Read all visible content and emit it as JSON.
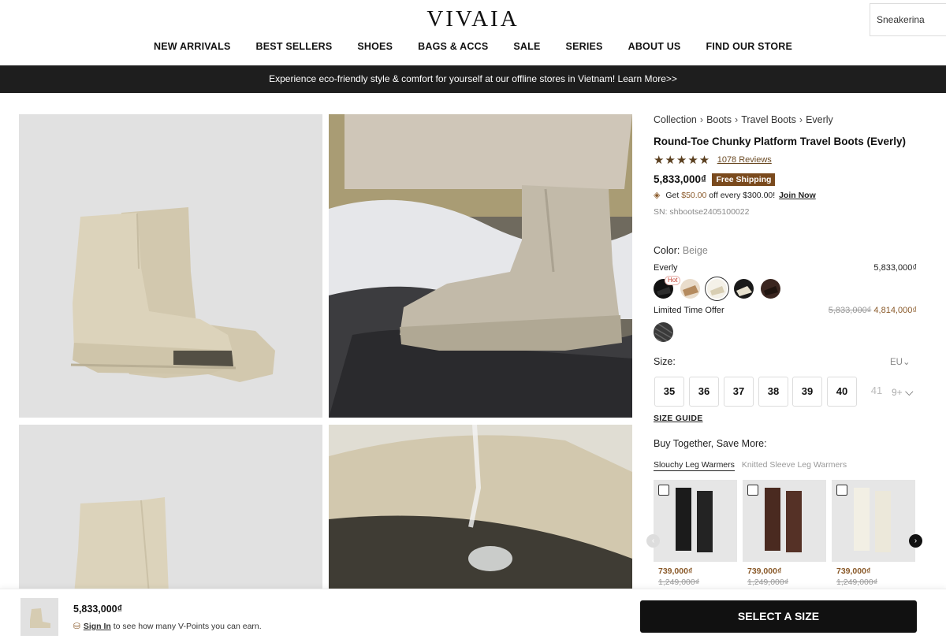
{
  "header": {
    "logo": "VIVAIA",
    "search_value": "Sneakerina",
    "nav": [
      "NEW ARRIVALS",
      "BEST SELLERS",
      "SHOES",
      "BAGS & ACCS",
      "SALE",
      "SERIES",
      "ABOUT US",
      "FIND OUR STORE"
    ]
  },
  "banner": {
    "text": "Experience eco-friendly style & comfort for yourself at our offline stores in Vietnam!  Learn More>>"
  },
  "product": {
    "breadcrumb": [
      "Collection",
      "Boots",
      "Travel Boots",
      "Everly"
    ],
    "title": "Round-Toe Chunky Platform Travel Boots (Everly)",
    "stars": "★★★★★",
    "rating": 5,
    "reviews": "1078 Reviews",
    "price": "5,833,000₫",
    "shipping_badge": "Free Shipping",
    "promo": {
      "prefix": "Get",
      "amount": "$50.00",
      "middle": "off every $300.00!",
      "link": "Join Now"
    },
    "sn": "SN: shbootse2405100022",
    "color": {
      "label": "Color:",
      "value": "Beige",
      "line_name": "Everly",
      "line_price": "5,833,000₫",
      "hot_badge": "Hot",
      "swatches": [
        {
          "name": "black",
          "color": "#111111"
        },
        {
          "name": "tan",
          "color": "#b48a5e"
        },
        {
          "name": "beige",
          "color": "#d8ceb3",
          "selected": true
        },
        {
          "name": "black-cream",
          "color": "#1a1a1a"
        },
        {
          "name": "dark-brown",
          "color": "#3b2620"
        }
      ],
      "offer_label": "Limited Time Offer",
      "offer_old_price": "5,833,000₫",
      "offer_price": "4,814,000₫",
      "offer_swatch": "grey-pattern"
    },
    "size": {
      "label": "Size:",
      "unit": "EU",
      "options": [
        "35",
        "36",
        "37",
        "38",
        "39",
        "40",
        "41"
      ],
      "more": "9+",
      "guide": "SIZE GUIDE"
    },
    "buy_together": {
      "title": "Buy Together, Save More:",
      "tabs": [
        "Slouchy Leg Warmers",
        "Knitted Sleeve Leg Warmers"
      ],
      "items": [
        {
          "price": "739,000₫",
          "old_price": "1,249,000₫",
          "color": "#1b1b1b"
        },
        {
          "price": "739,000₫",
          "old_price": "1,249,000₫",
          "color": "#4a2a20"
        },
        {
          "price": "739,000₫",
          "old_price": "1,249,000₫",
          "color": "#eeebdf"
        }
      ]
    }
  },
  "sticky": {
    "price": "5,833,000₫",
    "signin": "Sign In",
    "note": "to see how many V-Points you can earn.",
    "cta": "SELECT A SIZE"
  }
}
